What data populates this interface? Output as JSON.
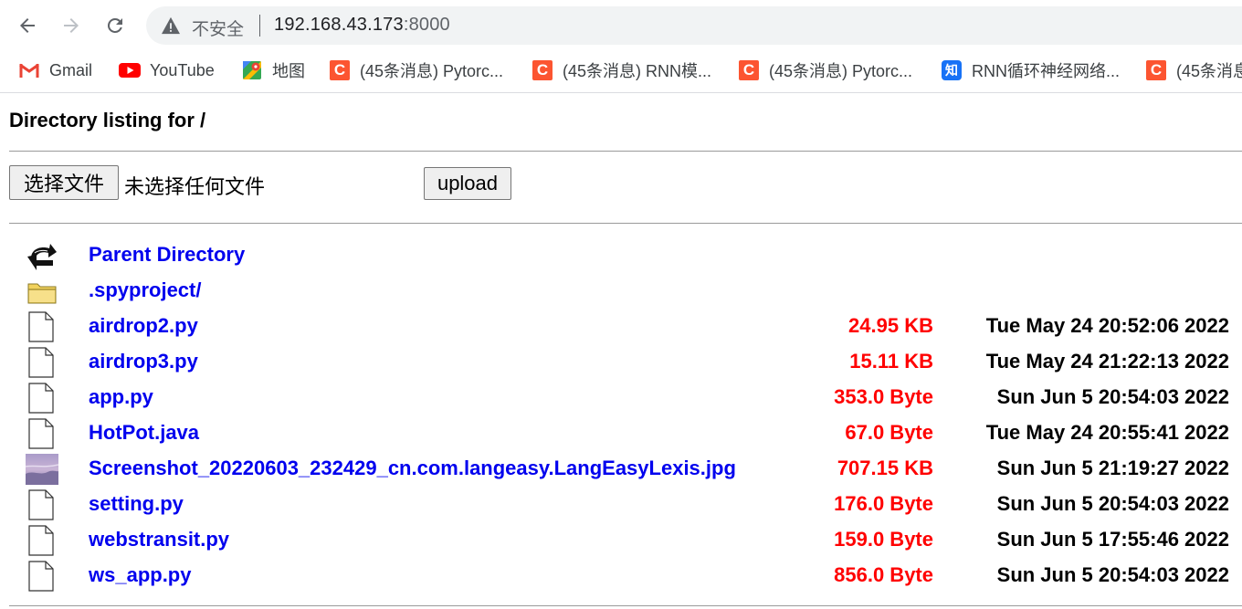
{
  "browser": {
    "insecure_label": "不安全",
    "url_host": "192.168.43.173",
    "url_port": ":8000",
    "bookmarks": [
      {
        "label": "Gmail",
        "icon": "gmail-icon"
      },
      {
        "label": "YouTube",
        "icon": "youtube-icon"
      },
      {
        "label": "地图",
        "icon": "maps-icon"
      },
      {
        "label": "(45条消息) Pytorc...",
        "icon": "csdn-icon"
      },
      {
        "label": "(45条消息) RNN模...",
        "icon": "csdn-icon"
      },
      {
        "label": "(45条消息) Pytorc...",
        "icon": "csdn-icon"
      },
      {
        "label": "RNN循环神经网络...",
        "icon": "zhihu-icon"
      },
      {
        "label": "(45条消息",
        "icon": "csdn-icon"
      }
    ],
    "icon_glyphs": {
      "csdn": "C",
      "zhihu": "知"
    }
  },
  "page": {
    "title": "Directory listing for /",
    "file_button_label": "选择文件",
    "file_status": "未选择任何文件",
    "upload_label": "upload"
  },
  "entries": [
    {
      "name": "Parent Directory",
      "size": "",
      "date": "",
      "icon": "back-arrow-icon"
    },
    {
      "name": ".spyproject/",
      "size": "",
      "date": "",
      "icon": "folder-icon"
    },
    {
      "name": "airdrop2.py",
      "size": "24.95 KB",
      "date": "Tue May 24 20:52:06 2022",
      "icon": "file-icon"
    },
    {
      "name": "airdrop3.py",
      "size": "15.11 KB",
      "date": "Tue May 24 21:22:13 2022",
      "icon": "file-icon"
    },
    {
      "name": "app.py",
      "size": "353.0 Byte",
      "date": "Sun Jun 5 20:54:03 2022",
      "icon": "file-icon"
    },
    {
      "name": "HotPot.java",
      "size": "67.0 Byte",
      "date": "Tue May 24 20:55:41 2022",
      "icon": "file-icon"
    },
    {
      "name": "Screenshot_20220603_232429_cn.com.langeasy.LangEasyLexis.jpg",
      "size": "707.15 KB",
      "date": "Sun Jun 5 21:19:27 2022",
      "icon": "image-thumbnail-icon"
    },
    {
      "name": "setting.py",
      "size": "176.0 Byte",
      "date": "Sun Jun 5 20:54:03 2022",
      "icon": "file-icon"
    },
    {
      "name": "webstransit.py",
      "size": "159.0 Byte",
      "date": "Sun Jun 5 17:55:46 2022",
      "icon": "file-icon"
    },
    {
      "name": "ws_app.py",
      "size": "856.0 Byte",
      "date": "Sun Jun 5 20:54:03 2022",
      "icon": "file-icon"
    }
  ],
  "colors": {
    "link": "#0000ee",
    "size": "#ff0000",
    "date": "#000000",
    "csdn": "#fc5531",
    "zhihu": "#1772f6"
  }
}
